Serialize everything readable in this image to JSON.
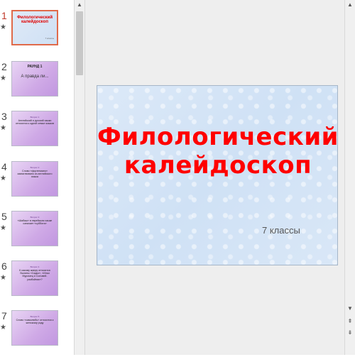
{
  "slides": [
    {
      "number": "1",
      "star": "★",
      "title": "Филологический калейдоскоп",
      "subtitle": "7 классы"
    },
    {
      "number": "2",
      "star": "★",
      "heading": "РАУНД 1",
      "body": "А правда ли..."
    },
    {
      "number": "3",
      "star": "★",
      "heading": "Вопрос 1",
      "body": "Английский и русский языки относятся к одной семье языков"
    },
    {
      "number": "4",
      "star": "★",
      "heading": "Вопрос 2",
      "body": "Слово «фортепиано» заимствовано из английского языка"
    },
    {
      "number": "5",
      "star": "★",
      "heading": "Вопрос 3",
      "body": "«Шабаш» в еврейском языке означает «суббота»"
    },
    {
      "number": "6",
      "star": "★",
      "heading": "Вопрос 4",
      "body": "К какому жанру относятся былины «Садко», «Илья Муромец и Соловей-разбойник»?"
    },
    {
      "number": "7",
      "star": "★",
      "heading": "Вопрос 5",
      "body": "Слово «самолюбь» относится к женскому роду"
    }
  ],
  "main_slide": {
    "title_line1": "Филологический",
    "title_line2": "калейдоскоп",
    "subtitle": "7 классы"
  },
  "scroll_icons": {
    "up": "▲",
    "down": "▼",
    "page_up": "⇞",
    "page_down": "⇟"
  },
  "colors": {
    "title": "#ff0000",
    "active_border": "#e06a4a",
    "thumb_bg": "#cfa9e6"
  }
}
